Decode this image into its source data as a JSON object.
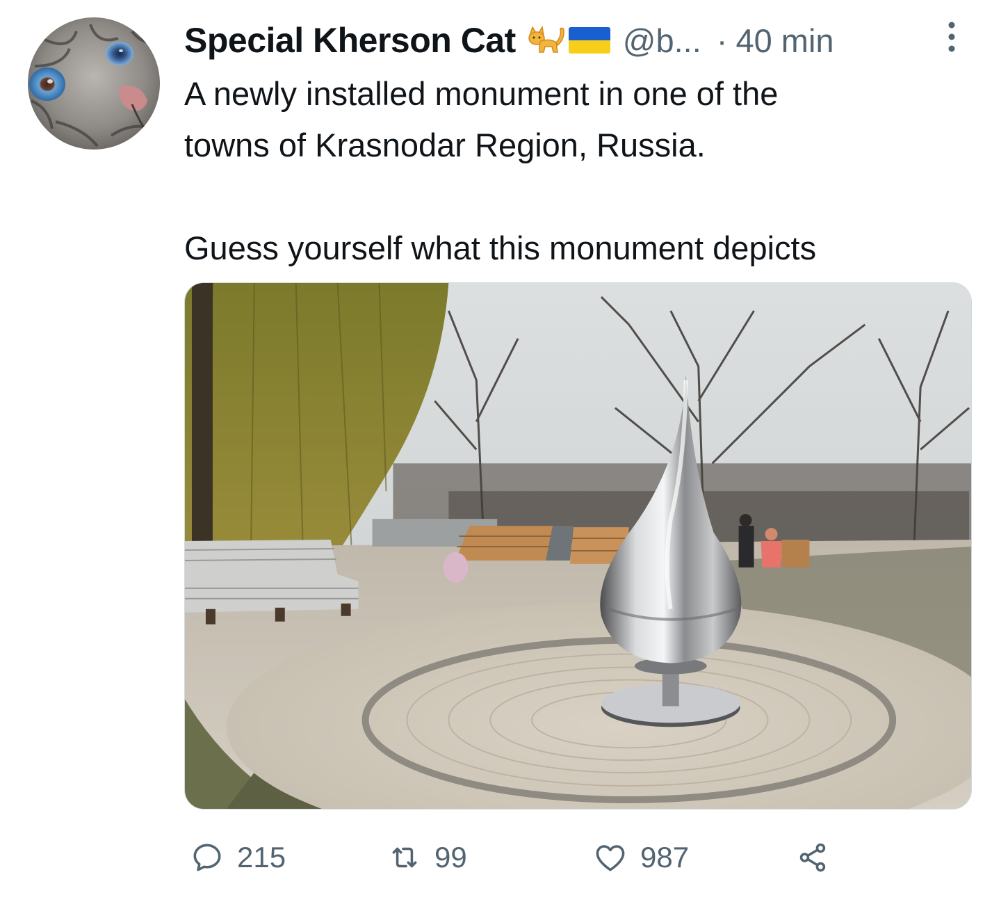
{
  "tweet": {
    "display_name": "Special Kherson Cat",
    "name_emojis": [
      "cat-emoji",
      "ukraine-flag-emoji"
    ],
    "handle": "@b...",
    "separator": "·",
    "time": "40 min",
    "text_lines": [
      "A newly installed monument in one of the",
      "towns of Krasnodar Region, Russia."
    ],
    "text_line_2": "Guess yourself what this monument depicts",
    "media_alt": ""
  },
  "actions": {
    "replies": "215",
    "retweets": "99",
    "likes": "987"
  },
  "icons": {
    "reply": "speech-bubble-icon",
    "retweet": "retweet-arrows-icon",
    "like": "heart-icon",
    "share": "share-nodes-icon",
    "more": "vertical-dots-icon"
  },
  "colors": {
    "text_primary": "#0f1419",
    "text_secondary": "#536471",
    "flag_blue": "#1a5fcf",
    "flag_yellow": "#f7cf1b"
  }
}
